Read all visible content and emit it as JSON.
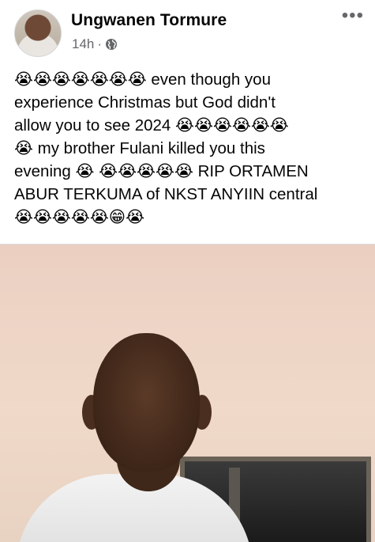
{
  "post": {
    "author": "Ungwanen Tormure",
    "time": "14h",
    "separator": "·",
    "privacy_icon": "globe-icon",
    "more_label": "•••",
    "lines": [
      "😭😭😭😭😭😭😭 even though you",
      "experience Christmas but God didn't",
      "allow you to see 2024 😭😭😭😭😭😭",
      "😭 my brother Fulani killed you this",
      "evening 😭 😭😭😭😭😭 RIP ORTAMEN",
      "ABUR TERKUMA of NKST ANYIIN central",
      "😭😭😭😭😭😁😭"
    ]
  },
  "colors": {
    "text": "#050505",
    "secondary": "#65676b",
    "divider": "#dadde1"
  }
}
